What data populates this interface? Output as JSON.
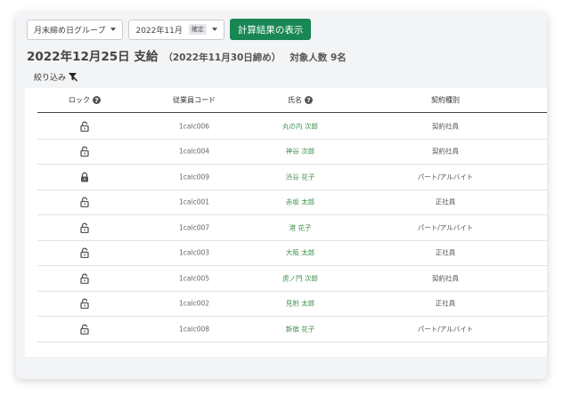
{
  "toolbar": {
    "group_select": "月末締め日グループ",
    "month_select": "2022年11月",
    "month_badge": "確定",
    "show_results_button": "計算結果の表示"
  },
  "heading": {
    "title": "2022年12月25日 支給",
    "closing": "（2022年11月30日締め）",
    "count": "対象人数 9名"
  },
  "filter": {
    "label": "絞り込み",
    "icon": "filter-clear-icon"
  },
  "table": {
    "headers": {
      "lock": "ロック",
      "code": "従業員コード",
      "name": "氏名",
      "contract": "契約種別"
    },
    "rows": [
      {
        "locked": false,
        "code": "1calc006",
        "name": "丸の内 次郎",
        "contract": "契約社員"
      },
      {
        "locked": false,
        "code": "1calc004",
        "name": "神谷 次郎",
        "contract": "契約社員"
      },
      {
        "locked": true,
        "code": "1calc009",
        "name": "渋谷 花子",
        "contract": "パート/アルバイト"
      },
      {
        "locked": false,
        "code": "1calc001",
        "name": "赤坂 太郎",
        "contract": "正社員"
      },
      {
        "locked": false,
        "code": "1calc007",
        "name": "港 花子",
        "contract": "パート/アルバイト"
      },
      {
        "locked": false,
        "code": "1calc003",
        "name": "大阪 太郎",
        "contract": "正社員"
      },
      {
        "locked": false,
        "code": "1calc005",
        "name": "虎ノ門 次郎",
        "contract": "契約社員"
      },
      {
        "locked": false,
        "code": "1calc002",
        "name": "見附 太郎",
        "contract": "正社員"
      },
      {
        "locked": false,
        "code": "1calc008",
        "name": "新宿 花子",
        "contract": "パート/アルバイト"
      }
    ]
  },
  "colors": {
    "accent_green": "#198754",
    "name_link": "#3f8f4e"
  }
}
